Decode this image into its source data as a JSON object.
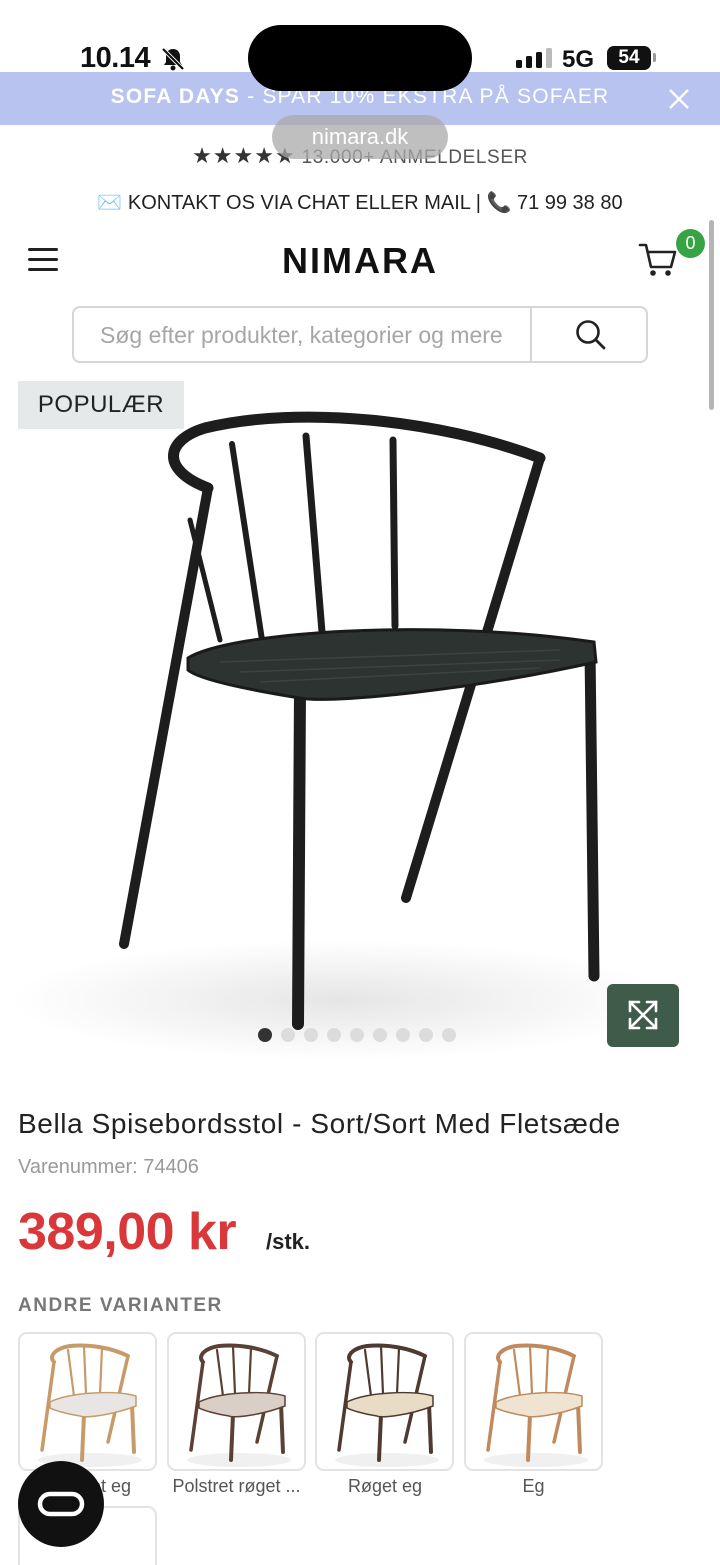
{
  "status_bar": {
    "time": "10.14",
    "network": "5G",
    "battery": "54"
  },
  "promo": {
    "highlight": "SOFA DAYS",
    "text": " - SPAR 10% EKSTRA PÅ SOFAER"
  },
  "browser": {
    "url": "nimara.dk"
  },
  "rating": {
    "stars": "★★★★★",
    "text": "13.000+ ANMELDELSER"
  },
  "contact": {
    "text": "✉️ KONTAKT OS VIA CHAT ELLER MAIL | 📞 71 99 38 80"
  },
  "header": {
    "logo": "NIMARA",
    "cart_count": "0"
  },
  "search": {
    "placeholder": "Søg efter produkter, kategorier og mere"
  },
  "product": {
    "badge": "POPULÆR",
    "title": "Bella Spisebordsstol - Sort/Sort Med Fletsæde",
    "sku": "Varenummer: 74406",
    "price": "389,00 kr",
    "unit": "/stk.",
    "image_count": 9,
    "active_image": 1
  },
  "variants": {
    "label": "ANDRE VARIANTER",
    "items": [
      {
        "label": "Polstret eg",
        "color": "#c79a6a",
        "seat": "#e8e6e4"
      },
      {
        "label": "Polstret røget ...",
        "color": "#5a4035",
        "seat": "#d9cfc7"
      },
      {
        "label": "Røget eg",
        "color": "#4e3a30",
        "seat": "#e8dcc6"
      },
      {
        "label": "Eg",
        "color": "#c08a5e",
        "seat": "#efe3d2"
      }
    ]
  },
  "colors": {
    "promo_bg": "#b9c3f0",
    "price": "#d9373a",
    "cart_badge": "#36a344",
    "expand_button": "#3f5b4a"
  }
}
